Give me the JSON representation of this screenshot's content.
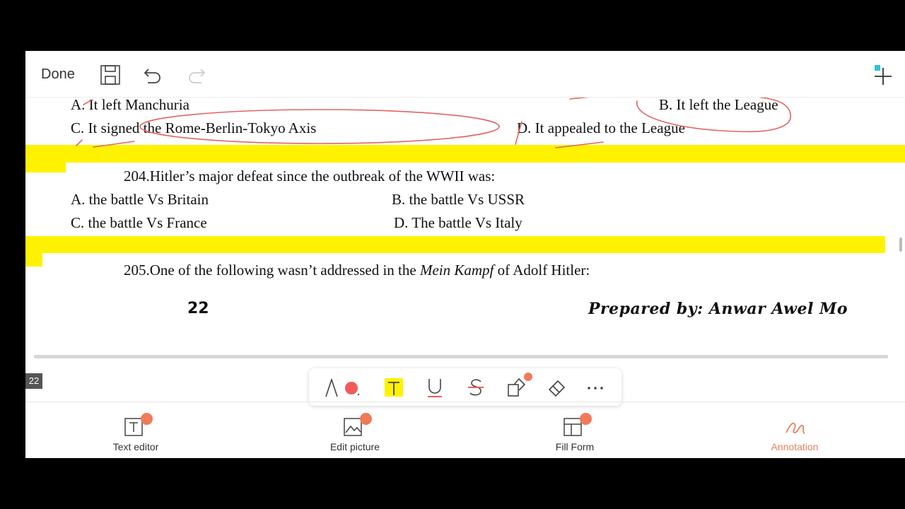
{
  "topbar": {
    "done_label": "Done"
  },
  "document": {
    "q203": {
      "option_a": "A. It left Manchuria",
      "option_b": "B. It left the League",
      "option_c": "C. It signed the Rome-Berlin-Tokyo Axis",
      "option_d": "D. It appealed to the League"
    },
    "q204": {
      "question": "204.Hitler’s major defeat since the outbreak of the WWII was:",
      "option_a": "A. the battle Vs Britain",
      "option_b": "B. the battle Vs USSR",
      "option_c": "C. the battle Vs France",
      "option_d": "D.  The battle Vs Italy"
    },
    "q205": {
      "question_before": "205.One of the following wasn’t addressed in the ",
      "question_italic": "Mein Kampf",
      "question_after": "  of Adolf Hitler:"
    },
    "footer": {
      "page_number": "22",
      "prepared_by": "Prepared by: Anwar Awel Mo"
    }
  },
  "page_badge": "22",
  "annotation_toolbar": {
    "tools": [
      "pen-icon",
      "text-highlight-icon",
      "underline-icon",
      "strikethrough-icon",
      "shapes-icon",
      "eraser-icon",
      "more-icon"
    ],
    "pen_color": "#f25a5a",
    "highlight_color": "#fff200"
  },
  "bottom_nav": {
    "items": [
      {
        "label": "Text editor",
        "icon": "text-editor-icon"
      },
      {
        "label": "Edit picture",
        "icon": "edit-picture-icon"
      },
      {
        "label": "Fill Form",
        "icon": "fill-form-icon"
      },
      {
        "label": "Annotation",
        "icon": "annotation-icon"
      }
    ],
    "active_color": "#e8805f"
  }
}
